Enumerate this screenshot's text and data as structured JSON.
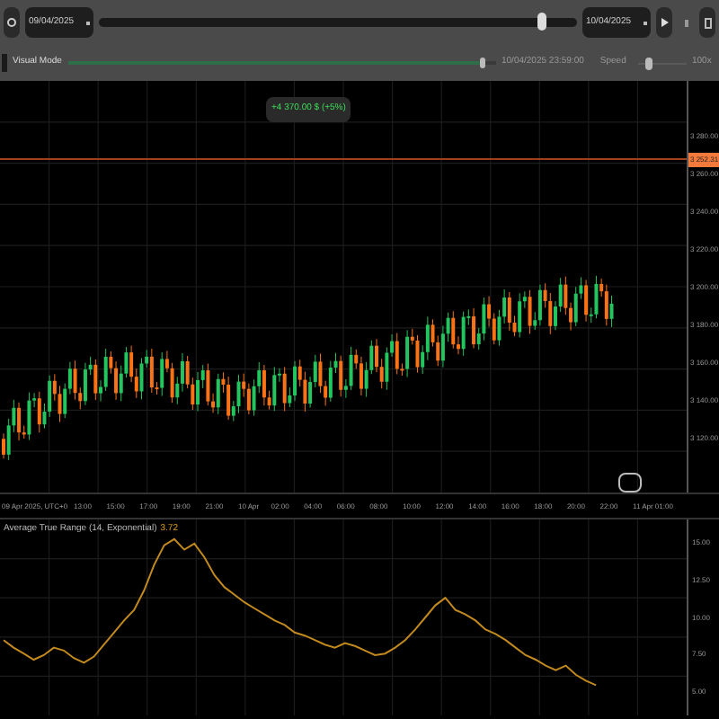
{
  "toolbar": {
    "start_date": "09/04/2025",
    "end_date": "10/04/2025",
    "timeline": {
      "level": 0.93
    }
  },
  "playback": {
    "visual_mode": {
      "label": "Visual Mode",
      "checked": false
    },
    "progress": {
      "level": 0.97
    },
    "current_time": "10/04/2025 23:59:00",
    "speed_label": "Speed",
    "speed": {
      "level": 0.2
    },
    "speed_value": "100x"
  },
  "chart": {
    "profit_badge": "+4 370.00 $ (+5%)",
    "price_label": "3 252.31",
    "price_ticks": [
      "3 280.00",
      "3 260.00",
      "3 240.00",
      "3 220.00",
      "3 200.00",
      "3 180.00",
      "3 160.00",
      "3 140.00",
      "3 120.00"
    ],
    "time_ticks": [
      "09 Apr 2025, UTC+0",
      "13:00",
      "15:00",
      "17:00",
      "19:00",
      "21:00",
      "10 Apr",
      "02:00",
      "04:00",
      "06:00",
      "08:00",
      "10:00",
      "12:00",
      "14:00",
      "16:00",
      "18:00",
      "20:00",
      "22:00",
      "11 Apr 01:00"
    ]
  },
  "indicator": {
    "value": "3.72",
    "chart_data": {
      "type": "line",
      "grid": true,
      "title": "Average True Range (14, Exponential)",
      "ylim": [
        3.5,
        16.5
      ],
      "yticks": [
        {
          "value": 15,
          "label": "15.00"
        },
        {
          "value": 12.5,
          "label": "12.50"
        },
        {
          "value": 10,
          "label": "10.00"
        },
        {
          "value": 7.5,
          "label": "7.50"
        },
        {
          "value": 5,
          "label": "5.00"
        }
      ],
      "series": [
        {
          "color": "#c28a1e",
          "values": [
            8.5,
            8.0,
            7.6,
            7.2,
            7.5,
            8.0,
            7.8,
            7.3,
            7.0,
            7.4,
            8.2,
            9.0,
            9.8,
            10.5,
            11.8,
            13.5,
            14.8,
            15.2,
            14.5,
            14.9,
            14.0,
            12.8,
            12.0,
            11.5,
            11.0,
            10.6,
            10.2,
            9.8,
            9.5,
            9.0,
            8.8,
            8.5,
            8.2,
            8.0,
            8.3,
            8.1,
            7.8,
            7.5,
            7.6,
            8.0,
            8.5,
            9.2,
            10.0,
            10.8,
            11.3,
            10.5,
            10.2,
            9.8,
            9.2,
            8.9,
            8.5,
            8.0,
            7.5,
            7.2,
            6.8,
            6.5,
            6.8,
            6.2,
            5.8,
            5.5
          ]
        }
      ]
    }
  }
}
